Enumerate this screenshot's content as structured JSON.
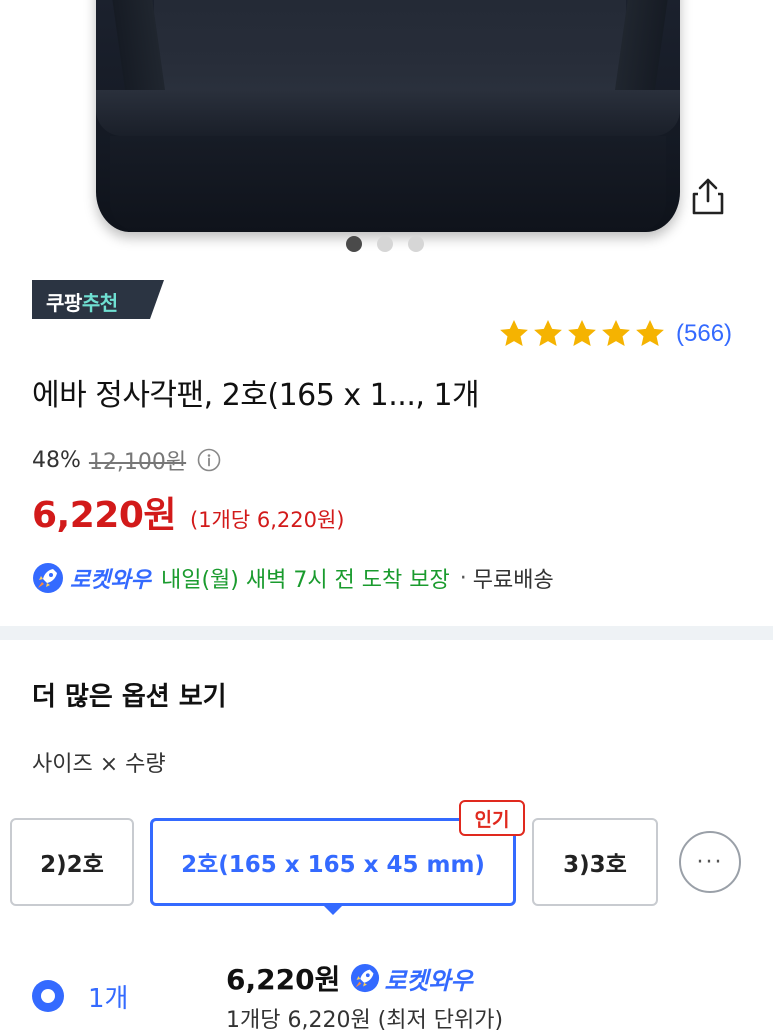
{
  "gallery": {
    "image_alt": "에바 정사각팬 product photo",
    "dot_count": 3,
    "active_dot": 0
  },
  "badge": {
    "part1": "쿠팡",
    "part2": "추천"
  },
  "rating": {
    "stars": 5,
    "count_text": "(566)"
  },
  "product": {
    "title": "에바 정사각팬, 2호(165 x 1..., 1개",
    "discount": "48%",
    "original_price": "12,100원",
    "price": "6,220원",
    "unit_price": "(1개당 6,220원)"
  },
  "delivery": {
    "rocket_label": "로켓와우",
    "arrival_text": "내일(월) 새벽 7시 전 도착 보장",
    "separator": "·",
    "free_shipping": "무료배송"
  },
  "options": {
    "section_title": "더 많은 옵션 보기",
    "option_type_label": "사이즈 × 수량",
    "items": [
      {
        "label": "2)2호"
      },
      {
        "label": "2호(165 x 165 x 45 mm)",
        "selected": true
      },
      {
        "label": "3)3호"
      }
    ],
    "popular_badge": "인기",
    "more_label": "···"
  },
  "quantity": {
    "label": "1개",
    "price": "6,220원",
    "rocket_label": "로켓와우",
    "unit_text": "1개당 6,220원 (최저 단위가)"
  },
  "colors": {
    "accent_blue": "#346aff",
    "price_red": "#d21a1a",
    "delivery_green": "#1a9b2e",
    "star_yellow": "#f5b301",
    "badge_bg": "#2b3442"
  }
}
